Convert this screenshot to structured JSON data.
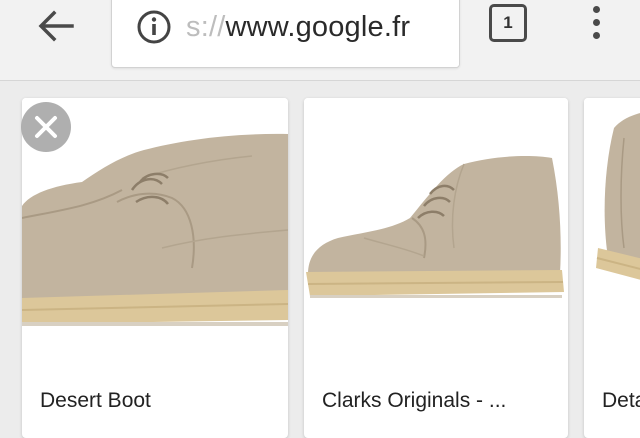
{
  "toolbar": {
    "url_scheme": "s://",
    "url_host": "www.google.fr",
    "tab_count": "1",
    "icons": [
      "back-arrow-icon",
      "info-icon",
      "tab-switcher-icon",
      "overflow-menu-icon"
    ]
  },
  "results": {
    "dismiss_icon": "close-icon",
    "items": [
      {
        "title": "Desert Boot"
      },
      {
        "title": "Clarks Originals - ..."
      },
      {
        "title": "Deta"
      }
    ]
  },
  "colors": {
    "toolbar_bg": "#f2f2f2",
    "page_bg": "#ececec",
    "boot_suede": "#c2b49f",
    "crepe_sole": "#dcc79a"
  }
}
